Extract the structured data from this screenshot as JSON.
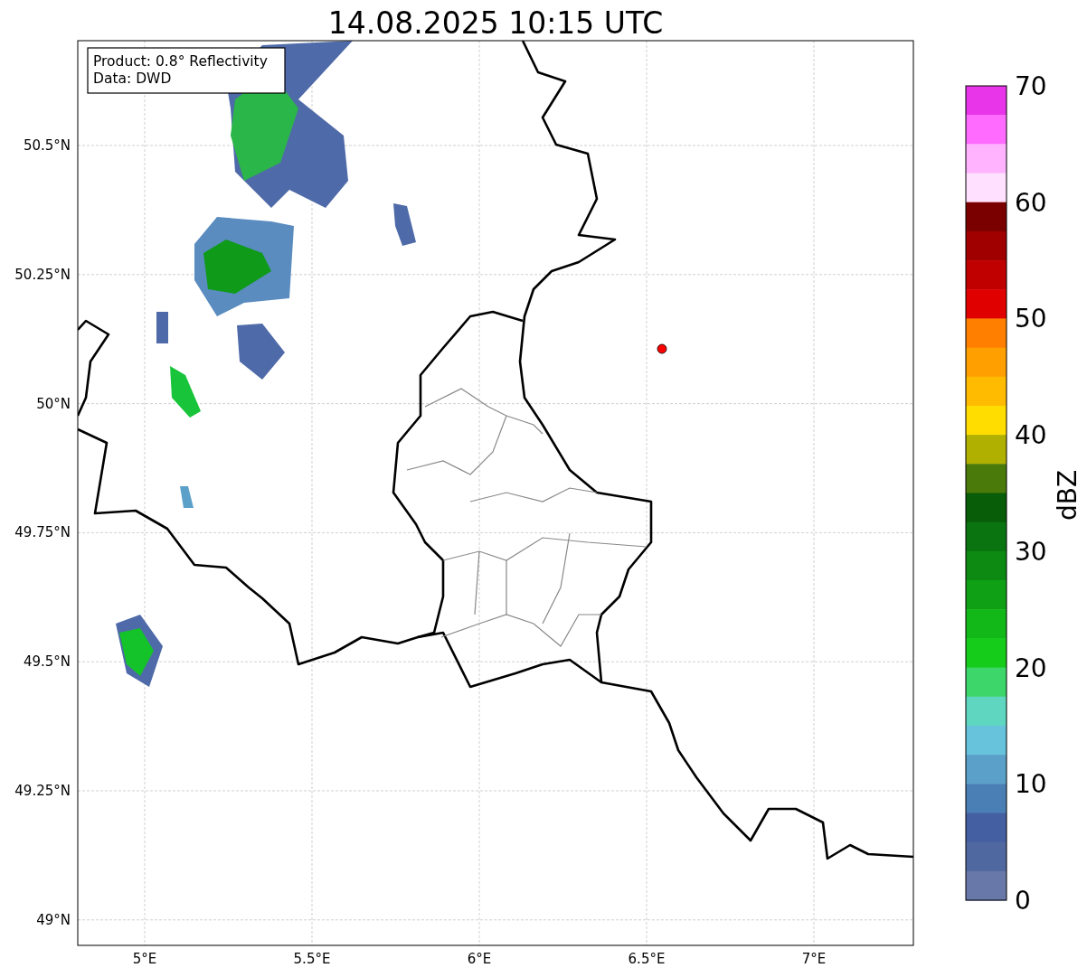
{
  "title": "14.08.2025 10:15 UTC",
  "legend": [
    "Product: 0.8° Reflectivity",
    "Data: DWD"
  ],
  "map": {
    "lat_ticks": [
      "50.5°N",
      "50.25°N",
      "50°N",
      "49.75°N",
      "49.5°N",
      "49.25°N",
      "49°N"
    ],
    "lon_ticks": [
      "5°E",
      "5.5°E",
      "6°E",
      "6.5°E",
      "7°E"
    ]
  },
  "colorbar": {
    "label": "dBZ",
    "ticks": [
      "70",
      "60",
      "50",
      "40",
      "30",
      "20",
      "10",
      "0"
    ],
    "bands": [
      {
        "color": "#e935e9"
      },
      {
        "color": "#ff6bff"
      },
      {
        "color": "#ffb3ff"
      },
      {
        "color": "#ffe0ff"
      },
      {
        "color": "#7a0000"
      },
      {
        "color": "#a00000"
      },
      {
        "color": "#c00000"
      },
      {
        "color": "#e00000"
      },
      {
        "color": "#ff7f00"
      },
      {
        "color": "#ff9f00"
      },
      {
        "color": "#ffbb00"
      },
      {
        "color": "#ffdd00"
      },
      {
        "color": "#b0b000"
      },
      {
        "color": "#4a7a0a"
      },
      {
        "color": "#085d08"
      },
      {
        "color": "#0a7510"
      },
      {
        "color": "#0d8a12"
      },
      {
        "color": "#0fa015"
      },
      {
        "color": "#12b818"
      },
      {
        "color": "#15cc1a"
      },
      {
        "color": "#3dd66b"
      },
      {
        "color": "#5fd7c0"
      },
      {
        "color": "#67c2dc"
      },
      {
        "color": "#5aa0c8"
      },
      {
        "color": "#4a7fb5"
      },
      {
        "color": "#4560a2"
      },
      {
        "color": "#5068a0"
      },
      {
        "color": "#6878a8"
      }
    ]
  }
}
